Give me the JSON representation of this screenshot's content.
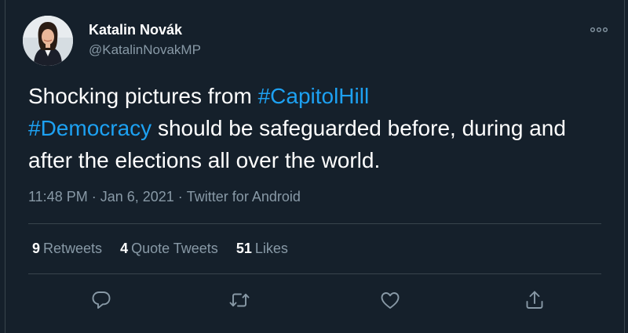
{
  "author": {
    "display_name": "Katalin Novák",
    "handle": "@KatalinNovakMP",
    "avatar": "person-photo"
  },
  "tweet": {
    "segments": [
      {
        "text": "Shocking pictures from ",
        "hashtag": false
      },
      {
        "text": "#CapitolHill",
        "hashtag": true
      },
      {
        "text": "\n",
        "hashtag": false
      },
      {
        "text": "#Democracy",
        "hashtag": true
      },
      {
        "text": " should be safeguarded before, during and\nafter the elections all over the world.",
        "hashtag": false
      }
    ]
  },
  "meta": {
    "time": "11:48 PM",
    "separator": "·",
    "date": "Jan 6, 2021",
    "source": "Twitter for Android"
  },
  "stats": {
    "retweets_count": "9",
    "retweets_label": "Retweets",
    "quote_count": "4",
    "quote_label": "Quote Tweets",
    "likes_count": "51",
    "likes_label": "Likes"
  },
  "icons": {
    "more": "more-horizontal-icon",
    "reply": "reply-icon",
    "retweet": "retweet-icon",
    "like": "heart-icon",
    "share": "share-icon"
  },
  "colors": {
    "background": "#15202b",
    "text": "#ffffff",
    "secondary": "#8899a6",
    "link": "#1da1f2",
    "border": "#38444d"
  }
}
